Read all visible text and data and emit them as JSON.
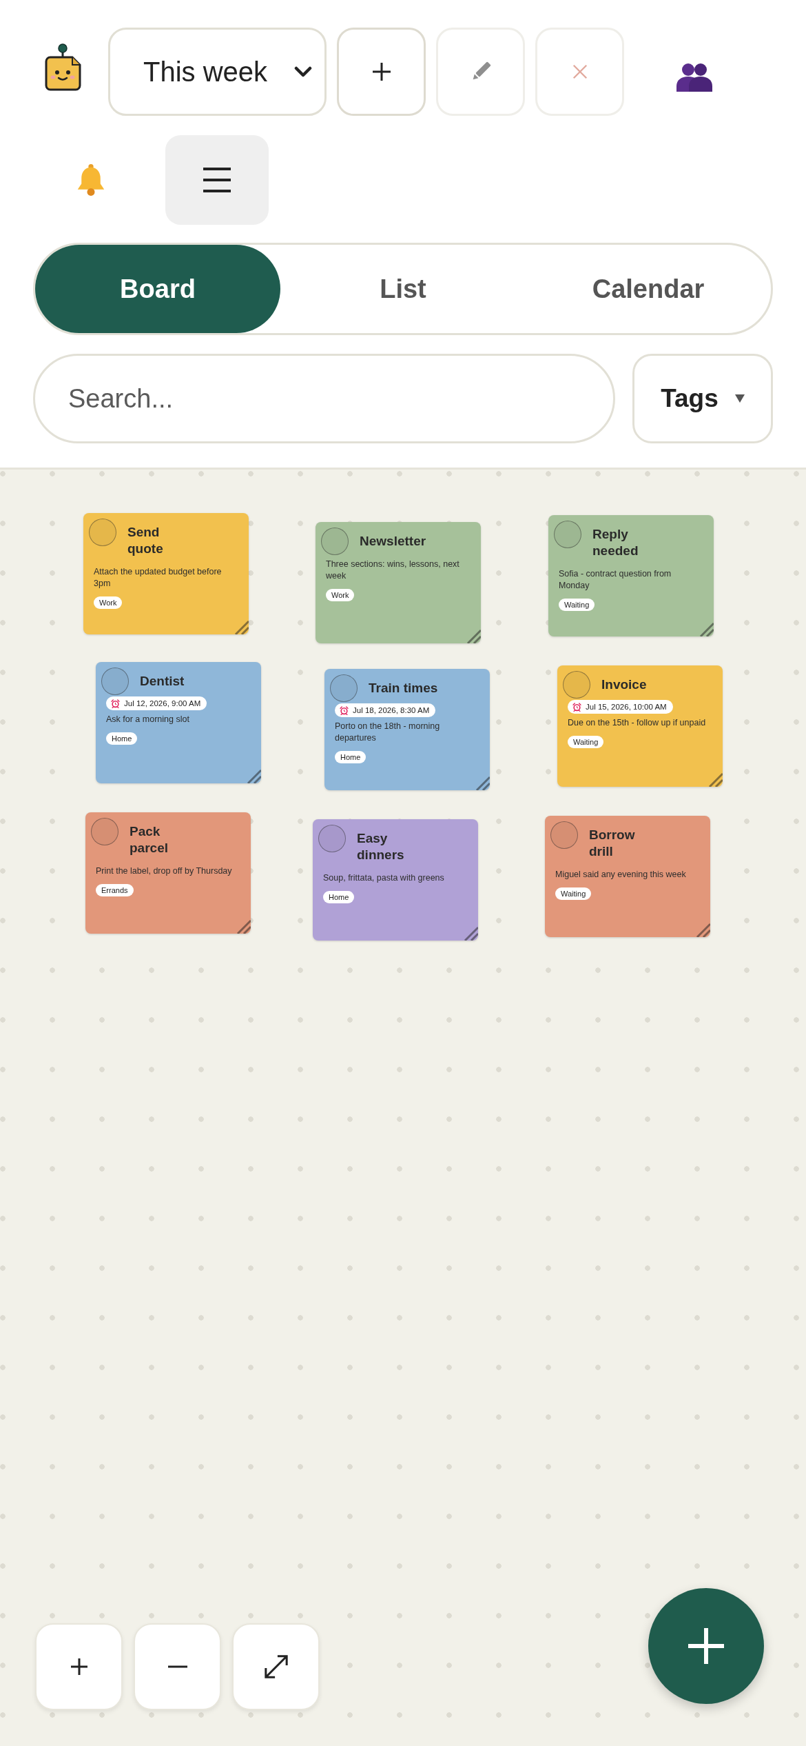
{
  "toolbar": {
    "board_select": {
      "value": "This week"
    },
    "buttons": [
      {
        "kind": "add",
        "disabled": false
      },
      {
        "kind": "edit",
        "disabled": true
      },
      {
        "kind": "delete",
        "disabled": true
      }
    ]
  },
  "view_tabs": [
    {
      "label": "Board",
      "selected": true
    },
    {
      "label": "List",
      "selected": false
    },
    {
      "label": "Calendar",
      "selected": false
    }
  ],
  "search": {
    "placeholder": "Search..."
  },
  "tag_filter": {
    "label": "Tags"
  },
  "notes": [
    {
      "title": "Send\nquote",
      "done": false,
      "text": "Attach the updated budget before 3pm",
      "tags": [
        "Work"
      ],
      "color": "#f2c14e"
    },
    {
      "title": "Newsletter",
      "done": false,
      "text": "Three sections: wins, lessons, next week",
      "tags": [
        "Work"
      ],
      "color": "#a6c19a"
    },
    {
      "title": "Reply\nneeded",
      "done": false,
      "text": "Sofia - contract question from Monday",
      "tags": [
        "Waiting"
      ],
      "color": "#a6c19a"
    },
    {
      "title": "Dentist",
      "done": false,
      "reminder": "Jul 12, 2026, 9:00 AM",
      "text": "Ask for a morning slot",
      "tags": [
        "Home"
      ],
      "color": "#8fb7d9"
    },
    {
      "title": "Train times",
      "done": false,
      "reminder": "Jul 18, 2026, 8:30 AM",
      "text": "Porto on the 18th - morning departures",
      "tags": [
        "Home"
      ],
      "color": "#8fb7d9"
    },
    {
      "title": "Invoice",
      "done": false,
      "reminder": "Jul 15, 2026, 10:00 AM",
      "text": "Due on the 15th - follow up if unpaid",
      "tags": [
        "Waiting"
      ],
      "color": "#f2c14e"
    },
    {
      "title": "Pack\nparcel",
      "done": false,
      "text": "Print the label, drop off by Thursday",
      "tags": [
        "Errands"
      ],
      "color": "#e2977a"
    },
    {
      "title": "Easy\ndinners",
      "done": false,
      "text": "Soup, frittata, pasta with greens",
      "tags": [
        "Home"
      ],
      "color": "#b0a1d6"
    },
    {
      "title": "Borrow\ndrill",
      "done": false,
      "text": "Miguel said any evening this week",
      "tags": [
        "Waiting"
      ],
      "color": "#e2977a"
    }
  ],
  "zoom_controls": [
    {
      "kind": "zoom_in"
    },
    {
      "kind": "zoom_out"
    },
    {
      "kind": "fit"
    }
  ]
}
